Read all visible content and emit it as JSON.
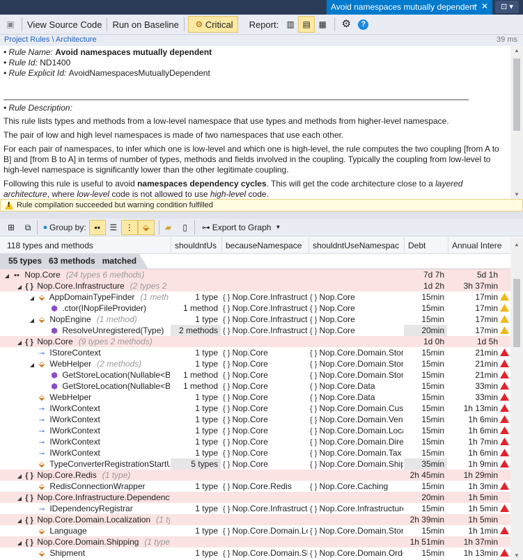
{
  "window": {
    "tab_title": "Avoid namespaces mutually dependent"
  },
  "toolbar": {
    "view_source": "View Source Code",
    "run_baseline": "Run on Baseline",
    "critical": "Critical",
    "report_label": "Report:"
  },
  "breadcrumb": {
    "project_rules": "Project Rules",
    "sep": " \\ ",
    "architecture": "Architecture",
    "time": "39 ms"
  },
  "rule": {
    "name_label": "• Rule Name: ",
    "name": "Avoid namespaces mutually dependent",
    "id_label": "• Rule Id: ",
    "id": "ND1400",
    "explicit_label": "• Rule Explicit Id: ",
    "explicit_id": "AvoidNamespacesMutuallyDependent",
    "desc_label": "• Rule Description:",
    "p1": "This rule lists types and methods from a low-level namespace that use types and methods from higher-level namespace.",
    "p2": "The pair of low and high level namespaces is made of two namespaces that use each other.",
    "p3": "For each pair of namespaces, to infer which one is low-level and which one is high-level, the rule computes the two coupling [from A to B] and [from B to A] in terms of number of types, methods and fields involved in the coupling. Typically the coupling from low-level to high-level namespace is significantly lower than the other legitimate coupling.",
    "p4a": "Following this rule is useful to avoid ",
    "p4b": "namespaces dependency cycles",
    "p4c": ". This will get the code architecture close to a ",
    "p4d": "layered architecture",
    "p4e": ", where ",
    "p4f": "low-level",
    "p4g": " code is not allowed to use ",
    "p4h": "high-level",
    "p4i": " code."
  },
  "warning": "Rule compilation succeeded but warning condition fulfilled",
  "toolbar2": {
    "group_by": "Group by:",
    "export": "Export to Graph"
  },
  "columns": [
    "118 types and methods",
    "shouldntUs",
    "becauseNamespace",
    "shouldntUseNamespac",
    "Debt",
    "Annual Intere"
  ],
  "matched": {
    "types": "55 types",
    "methods": "63 methods",
    "suffix": "matched"
  },
  "rows": [
    {
      "indent": 0,
      "exp": "◢",
      "icon": "asm",
      "name": "Nop.Core",
      "extra": "(24 types   6 methods)",
      "sh": "",
      "bn": "",
      "snu": "",
      "debt": "7d  7h",
      "ai": "5d  1h",
      "pink": true,
      "sev": ""
    },
    {
      "indent": 1,
      "exp": "◢",
      "icon": "ns",
      "name": "Nop.Core.Infrastructure",
      "extra": "(2 types   2",
      "sh": "",
      "bn": "",
      "snu": "",
      "debt": "1d  2h",
      "ai": "3h  37min",
      "pink": true,
      "sev": ""
    },
    {
      "indent": 2,
      "exp": "◢",
      "icon": "type",
      "name": "AppDomainTypeFinder",
      "extra": "(1 meth",
      "sh": "1 type",
      "bn": "Nop.Core.Infrastructu",
      "snu": "Nop.Core",
      "debt": "15min",
      "ai": "17min",
      "pink": false,
      "sev": "yel"
    },
    {
      "indent": 3,
      "exp": "",
      "icon": "ctor",
      "name": ".ctor(INopFileProvider)",
      "extra": "",
      "sh": "1 method",
      "bn": "Nop.Core.Infrastructu",
      "snu": "Nop.Core",
      "debt": "15min",
      "ai": "17min",
      "pink": false,
      "sev": "yel"
    },
    {
      "indent": 2,
      "exp": "◢",
      "icon": "type",
      "name": "NopEngine",
      "extra": "(1 method)",
      "sh": "1 type",
      "bn": "Nop.Core.Infrastructu",
      "snu": "Nop.Core",
      "debt": "15min",
      "ai": "17min",
      "pink": false,
      "sev": "yel"
    },
    {
      "indent": 3,
      "exp": "",
      "icon": "meth",
      "name": "ResolveUnregistered(Type)",
      "extra": "",
      "sh": "2 methods",
      "bn": "Nop.Core.Infrastructu",
      "snu": "Nop.Core",
      "debt": "20min",
      "ai": "17min",
      "pink": false,
      "sev": "yel",
      "hl": true
    },
    {
      "indent": 1,
      "exp": "◢",
      "icon": "ns",
      "name": "Nop.Core",
      "extra": "(9 types   2 methods)",
      "sh": "",
      "bn": "",
      "snu": "",
      "debt": "1d  0h",
      "ai": "1d  5h",
      "pink": true,
      "sev": ""
    },
    {
      "indent": 2,
      "exp": "",
      "icon": "ifc",
      "name": "IStoreContext",
      "extra": "",
      "sh": "1 type",
      "bn": "Nop.Core",
      "snu": "Nop.Core.Domain.Store",
      "debt": "15min",
      "ai": "21min",
      "pink": false,
      "sev": "red"
    },
    {
      "indent": 2,
      "exp": "◢",
      "icon": "type",
      "name": "WebHelper",
      "extra": "(2 methods)",
      "sh": "1 type",
      "bn": "Nop.Core",
      "snu": "Nop.Core.Domain.Store",
      "debt": "15min",
      "ai": "21min",
      "pink": false,
      "sev": "red"
    },
    {
      "indent": 3,
      "exp": "",
      "icon": "meth",
      "name": "GetStoreLocation(Nullable<Bo",
      "extra": "",
      "sh": "1 method",
      "bn": "Nop.Core",
      "snu": "Nop.Core.Domain.Store",
      "debt": "15min",
      "ai": "21min",
      "pink": false,
      "sev": "red"
    },
    {
      "indent": 3,
      "exp": "",
      "icon": "meth",
      "name": "GetStoreLocation(Nullable<Bo",
      "extra": "",
      "sh": "1 method",
      "bn": "Nop.Core",
      "snu": "Nop.Core.Data",
      "debt": "15min",
      "ai": "33min",
      "pink": false,
      "sev": "red"
    },
    {
      "indent": 2,
      "exp": "",
      "icon": "type",
      "name": "WebHelper",
      "extra": "",
      "sh": "1 type",
      "bn": "Nop.Core",
      "snu": "Nop.Core.Data",
      "debt": "15min",
      "ai": "33min",
      "pink": false,
      "sev": "red"
    },
    {
      "indent": 2,
      "exp": "",
      "icon": "ifc",
      "name": "IWorkContext",
      "extra": "",
      "sh": "1 type",
      "bn": "Nop.Core",
      "snu": "Nop.Core.Domain.Cust",
      "debt": "15min",
      "ai": "1h  13min",
      "pink": false,
      "sev": "red"
    },
    {
      "indent": 2,
      "exp": "",
      "icon": "ifc",
      "name": "IWorkContext",
      "extra": "",
      "sh": "1 type",
      "bn": "Nop.Core",
      "snu": "Nop.Core.Domain.Vend",
      "debt": "15min",
      "ai": "1h  6min",
      "pink": false,
      "sev": "red"
    },
    {
      "indent": 2,
      "exp": "",
      "icon": "ifc",
      "name": "IWorkContext",
      "extra": "",
      "sh": "1 type",
      "bn": "Nop.Core",
      "snu": "Nop.Core.Domain.Loca",
      "debt": "15min",
      "ai": "1h  6min",
      "pink": false,
      "sev": "red"
    },
    {
      "indent": 2,
      "exp": "",
      "icon": "ifc",
      "name": "IWorkContext",
      "extra": "",
      "sh": "1 type",
      "bn": "Nop.Core",
      "snu": "Nop.Core.Domain.Direc",
      "debt": "15min",
      "ai": "1h  7min",
      "pink": false,
      "sev": "red"
    },
    {
      "indent": 2,
      "exp": "",
      "icon": "ifc",
      "name": "IWorkContext",
      "extra": "",
      "sh": "1 type",
      "bn": "Nop.Core",
      "snu": "Nop.Core.Domain.Tax",
      "debt": "15min",
      "ai": "1h  6min",
      "pink": false,
      "sev": "red"
    },
    {
      "indent": 2,
      "exp": "",
      "icon": "type",
      "name": "TypeConverterRegistrationStartU",
      "extra": "",
      "sh": "5 types",
      "bn": "Nop.Core",
      "snu": "Nop.Core.Domain.Ship",
      "debt": "35min",
      "ai": "1h  9min",
      "pink": false,
      "sev": "red",
      "hl": true
    },
    {
      "indent": 1,
      "exp": "◢",
      "icon": "ns",
      "name": "Nop.Core.Redis",
      "extra": "(1 type)",
      "sh": "",
      "bn": "",
      "snu": "",
      "debt": "2h  45min",
      "ai": "1h  29min",
      "pink": true,
      "sev": ""
    },
    {
      "indent": 2,
      "exp": "",
      "icon": "type",
      "name": "RedisConnectionWrapper",
      "extra": "",
      "sh": "1 type",
      "bn": "Nop.Core.Redis",
      "snu": "Nop.Core.Caching",
      "debt": "15min",
      "ai": "1h  3min",
      "pink": false,
      "sev": "red"
    },
    {
      "indent": 1,
      "exp": "◢",
      "icon": "ns",
      "name": "Nop.Core.Infrastructure.DependencyM",
      "extra": "",
      "sh": "",
      "bn": "",
      "snu": "",
      "debt": "20min",
      "ai": "1h  5min",
      "pink": true,
      "sev": ""
    },
    {
      "indent": 2,
      "exp": "",
      "icon": "ifc",
      "name": "IDependencyRegistrar",
      "extra": "",
      "sh": "1 type",
      "bn": "Nop.Core.Infrastructu",
      "snu": "Nop.Core.Infrastructure",
      "debt": "15min",
      "ai": "1h  5min",
      "pink": false,
      "sev": "red"
    },
    {
      "indent": 1,
      "exp": "◢",
      "icon": "ns",
      "name": "Nop.Core.Domain.Localization",
      "extra": "(1 ty",
      "sh": "",
      "bn": "",
      "snu": "",
      "debt": "2h  39min",
      "ai": "1h  5min",
      "pink": true,
      "sev": ""
    },
    {
      "indent": 2,
      "exp": "",
      "icon": "type",
      "name": "Language",
      "extra": "",
      "sh": "1 type",
      "bn": "Nop.Core.Domain.Lo",
      "snu": "Nop.Core.Domain.Store",
      "debt": "15min",
      "ai": "1h  1min",
      "pink": false,
      "sev": "red"
    },
    {
      "indent": 1,
      "exp": "◢",
      "icon": "ns",
      "name": "Nop.Core.Domain.Shipping",
      "extra": "(1 type)",
      "sh": "",
      "bn": "",
      "snu": "",
      "debt": "1h  51min",
      "ai": "1h  37min",
      "pink": true,
      "sev": ""
    },
    {
      "indent": 2,
      "exp": "",
      "icon": "type",
      "name": "Shipment",
      "extra": "",
      "sh": "1 type",
      "bn": "Nop.Core.Domain.Sh",
      "snu": "Nop.Core.Domain.Orde",
      "debt": "15min",
      "ai": "1h  13min",
      "pink": false,
      "sev": "red"
    }
  ]
}
